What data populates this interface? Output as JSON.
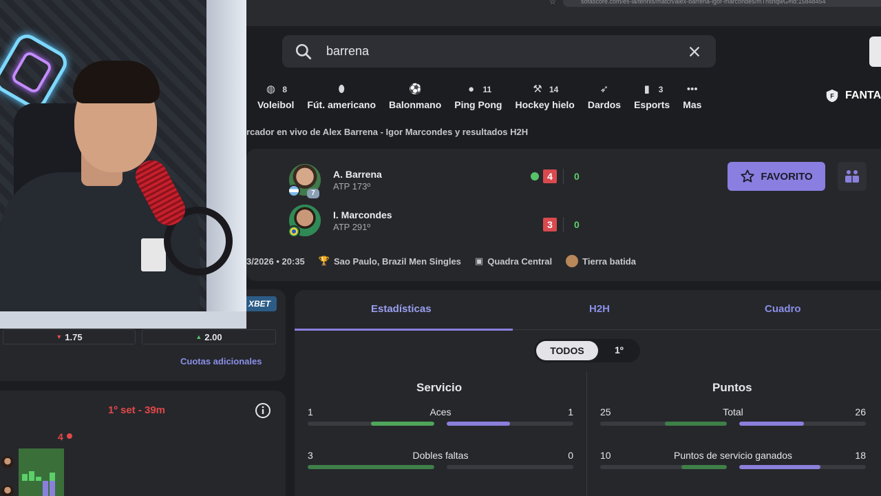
{
  "browser": {
    "url": "sofascore.com/es-la/tennis/match/alex-barrena-igor-marcondes/mTnshqwG#id:15848454"
  },
  "search": {
    "value": "barrena"
  },
  "sports": [
    {
      "label": "Voleibol",
      "count": "8",
      "icon": "volleyball-icon"
    },
    {
      "label": "Fút. americano",
      "count": "",
      "icon": "american-football-icon"
    },
    {
      "label": "Balonmano",
      "count": "",
      "icon": "handball-icon"
    },
    {
      "label": "Ping Pong",
      "count": "11",
      "icon": "table-tennis-icon"
    },
    {
      "label": "Hockey hielo",
      "count": "14",
      "icon": "ice-hockey-icon"
    },
    {
      "label": "Dardos",
      "count": "",
      "icon": "darts-icon"
    },
    {
      "label": "Esports",
      "count": "3",
      "icon": "esports-icon"
    },
    {
      "label": "Mas",
      "count": "",
      "icon": "more-icon"
    }
  ],
  "fantasy_label": "FANTA",
  "breadcrumb": "rcador en vivo de Alex Barrena - Igor Marcondes y resultados H2H",
  "match": {
    "player1": {
      "name": "A. Barrena",
      "rank": "ATP 173º",
      "seed": "7",
      "set_score": "4",
      "game_score": "0"
    },
    "player2": {
      "name": "I. Marcondes",
      "rank": "ATP 291º",
      "set_score": "3",
      "game_score": "0"
    },
    "favorite_label": "FAVORITO",
    "datetime": "3/2026 • 20:35",
    "tournament": "Sao Paulo, Brazil Men Singles",
    "court": "Quadra Central",
    "surface": "Tierra batida"
  },
  "odds": {
    "bookmaker": "XBET",
    "home": "1.75",
    "away": "2.00",
    "more_label": "Cuotas adicionales"
  },
  "momentum": {
    "title": "1º set - 39m",
    "score": "4"
  },
  "stats": {
    "tabs": [
      "Estadísticas",
      "H2H",
      "Cuadro"
    ],
    "periods": [
      "TODOS",
      "1º"
    ],
    "serve_title": "Servicio",
    "points_title": "Puntos",
    "serve_rows": [
      {
        "label": "Aces",
        "left": "1",
        "right": "1",
        "left_frac": 0.5,
        "right_frac": 0.5
      },
      {
        "label": "Dobles faltas",
        "left": "3",
        "right": "0",
        "left_frac": 1.0,
        "right_frac": 0.0
      }
    ],
    "points_rows": [
      {
        "label": "Total",
        "left": "25",
        "right": "26",
        "left_frac": 0.49,
        "right_frac": 0.51
      },
      {
        "label": "Puntos de servicio ganados",
        "left": "10",
        "right": "18",
        "left_frac": 0.36,
        "right_frac": 0.64
      }
    ]
  },
  "colors": {
    "accent": "#8a7fe0",
    "home_bar": "#4fa55a",
    "away_bar": "#8a80dc",
    "live_red": "#d94a4f"
  }
}
